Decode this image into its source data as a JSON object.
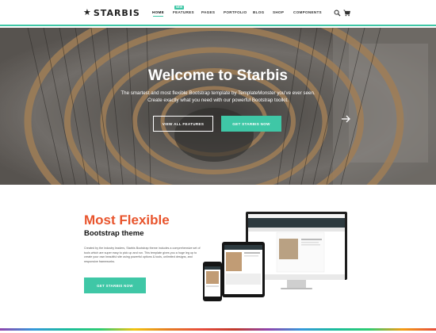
{
  "brand": {
    "name": "STARBIS"
  },
  "nav": {
    "items": [
      {
        "label": "HOME",
        "active": true
      },
      {
        "label": "FEATURES",
        "badge": "NEW"
      },
      {
        "label": "PAGES"
      },
      {
        "label": "PORTFOLIO"
      },
      {
        "label": "BLOG"
      },
      {
        "label": "SHOP"
      },
      {
        "label": "COMPONENTS"
      }
    ],
    "icons": [
      "search-icon",
      "cart-icon"
    ]
  },
  "hero": {
    "title": "Welcome to Starbis",
    "subtitle": "The smartest and most flexible Bootstrap template by TemplateMonster you've ever seen. Create exactly what you need with our powerful Bootstrap toolkit.",
    "primary_button": "VIEW ALL FEATURES",
    "secondary_button": "GET STARBIS NOW",
    "next_icon": "arrow-right-icon"
  },
  "feature": {
    "title": "Most Flexible",
    "subtitle": "Bootstrap theme",
    "text": "Created by the industry leaders, Starbis Bootstrap theme includes a comprehensive set of tools which are super easy to pick up and run. This template gives you a huge leg up to create your own beautiful site using powerful options & tools, unlimited designs, and responsive frameworks.",
    "button": "GET STARBIS NOW"
  },
  "colors": {
    "accent": "#3fc7a6",
    "headline": "#e8542c"
  }
}
